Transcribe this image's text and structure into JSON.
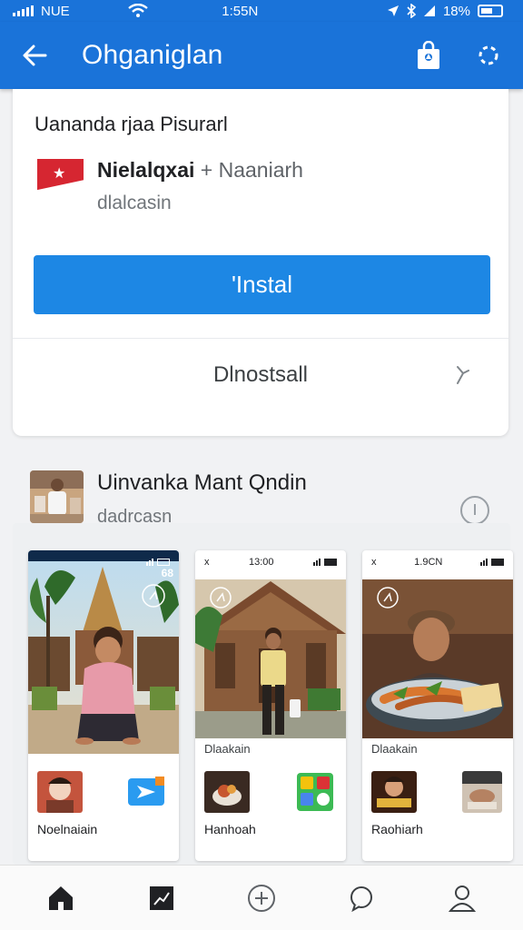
{
  "status_bar": {
    "carrier": "NUE",
    "time": "1:55N",
    "battery": "18%"
  },
  "app_bar": {
    "title": "Ohganiglan",
    "icons": [
      "back-arrow-icon",
      "shopping-bag-icon",
      "settings-icon"
    ]
  },
  "install_card": {
    "heading": "Uananda rjaa Pisurarl",
    "app_name": "Nielalqxai",
    "app_name_secondary": "+ Naaniarh",
    "app_subtitle": "dlalcasin",
    "install_label": "'Instal",
    "uninstall_label": "Dlnostsall",
    "logo_colors": {
      "background": "#d62631",
      "accent": "#ffffff"
    },
    "accent_color": "#1d87e4"
  },
  "recommendation": {
    "title": "Uinvanka Mant Qndin",
    "subtitle": "dadrcasn"
  },
  "screenshots": [
    {
      "status_left": "",
      "status_time": "",
      "status_right": "",
      "corner_label": "68",
      "caption": "",
      "footer": "Noelnaiain"
    },
    {
      "status_left": "x",
      "status_time": "13:00",
      "status_right": "",
      "corner_label": "",
      "caption": "Dlaakain",
      "footer": "Hanhoah"
    },
    {
      "status_left": "x",
      "status_time": "1.9CN",
      "status_right": "",
      "corner_label": "",
      "caption": "Dlaakain",
      "footer": "Raohiarh"
    }
  ],
  "bottom_nav": [
    "home-icon",
    "charts-icon",
    "add-circle-icon",
    "chat-icon",
    "profile-icon"
  ]
}
